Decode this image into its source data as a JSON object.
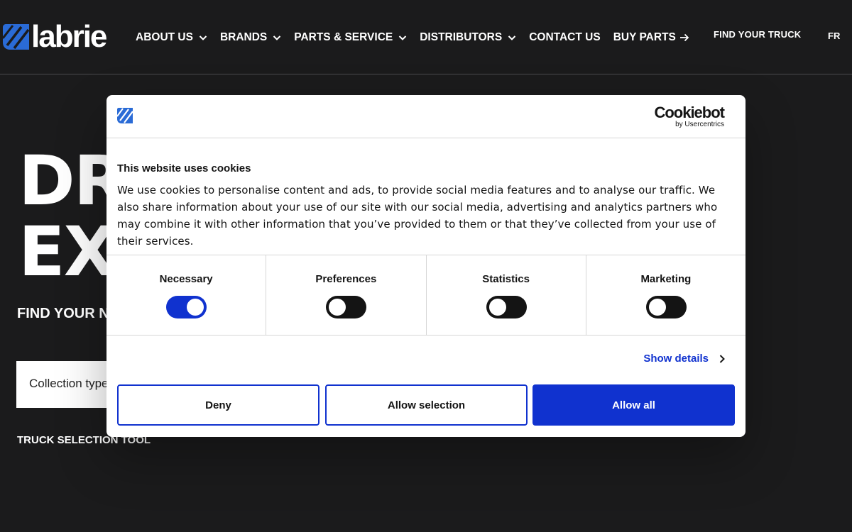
{
  "brand": {
    "logo_text": "labrie",
    "accent": "#1032cf",
    "logo_blue": "#2a6bd6"
  },
  "nav": {
    "items": [
      {
        "label": "ABOUT US",
        "icon": "chevron-down-icon"
      },
      {
        "label": "BRANDS",
        "icon": "chevron-down-icon"
      },
      {
        "label": "PARTS & SERVICE",
        "icon": "chevron-down-icon"
      },
      {
        "label": "DISTRIBUTORS",
        "icon": "chevron-down-icon"
      },
      {
        "label": "CONTACT US"
      },
      {
        "label": "BUY PARTS",
        "icon": "arrow-right-icon"
      }
    ],
    "find_truck": "FIND YOUR TRUCK",
    "language": "FR"
  },
  "hero": {
    "title_line1": "DR",
    "title_line2": "EX",
    "subtitle": "FIND YOUR N",
    "collection_placeholder": "Collection type",
    "tool_label": "TRUCK SELECTION TOOL"
  },
  "cookie_dialog": {
    "provider_name": "Cookiebot",
    "provider_by": "by Usercentrics",
    "title": "This website uses cookies",
    "text": "We use cookies to personalise content and ads, to provide social media features and to analyse our traffic. We also share information about your use of our site with our social media, advertising and analytics partners who may combine it with other information that you’ve provided to them or that they’ve collected from your use of their services.",
    "toggles": [
      {
        "label": "Necessary",
        "on": true
      },
      {
        "label": "Preferences",
        "on": false
      },
      {
        "label": "Statistics",
        "on": false
      },
      {
        "label": "Marketing",
        "on": false
      }
    ],
    "show_details": "Show details",
    "buttons": {
      "deny": "Deny",
      "allow_selection": "Allow selection",
      "allow_all": "Allow all"
    }
  }
}
